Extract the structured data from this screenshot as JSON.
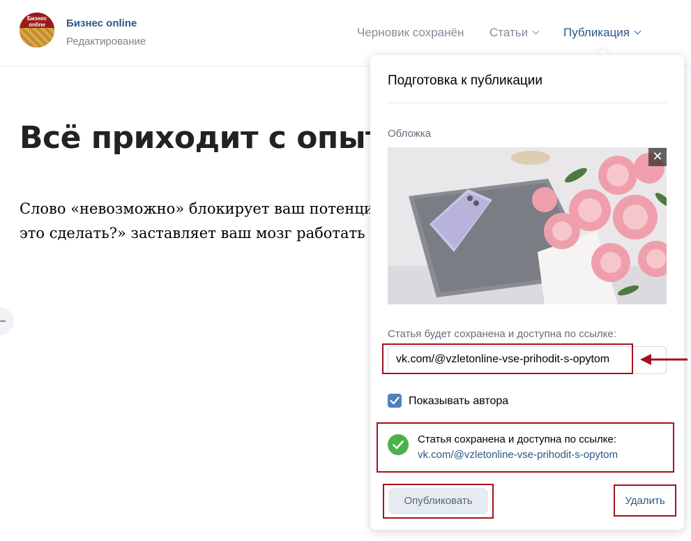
{
  "header": {
    "logo_text_line1": "Бизнес",
    "logo_text_line2": "online",
    "group_name": "Бизнес online",
    "group_subtitle": "Редактирование",
    "nav": {
      "draft_status": "Черновик сохранён",
      "articles": "Статьи",
      "publication": "Публикация"
    }
  },
  "article": {
    "title": "Всё приходит с опыто",
    "paragraph_line1": "Слово «невозможно» блокирует ваш потенци",
    "paragraph_line2": "это сделать?» заставляет ваш мозг работать н"
  },
  "popup": {
    "title": "Подготовка к публикации",
    "cover_label": "Обложка",
    "cover_close": "✕",
    "url_label": "Статья будет сохранена и доступна по ссылке:",
    "url_value": "vk.com/@vzletonline-vse-prihodit-s-opytom",
    "show_author_label": "Показывать автора",
    "show_author_checked": true,
    "saved_message": "Статья сохранена и доступна по ссылке:",
    "saved_link": "vk.com/@vzletonline-vse-prihodit-s-opytom",
    "publish_button": "Опубликовать",
    "delete_button": "Удалить"
  },
  "colors": {
    "link_blue": "#2a5885",
    "checkbox_blue": "#5181b8",
    "success_green": "#4bb34b",
    "highlight_red": "#a3121c"
  },
  "icons": {
    "cover_close": "close-icon",
    "checkbox": "checkmark-icon",
    "saved_status": "check-circle-icon",
    "annotation": "red-arrow-icon"
  }
}
